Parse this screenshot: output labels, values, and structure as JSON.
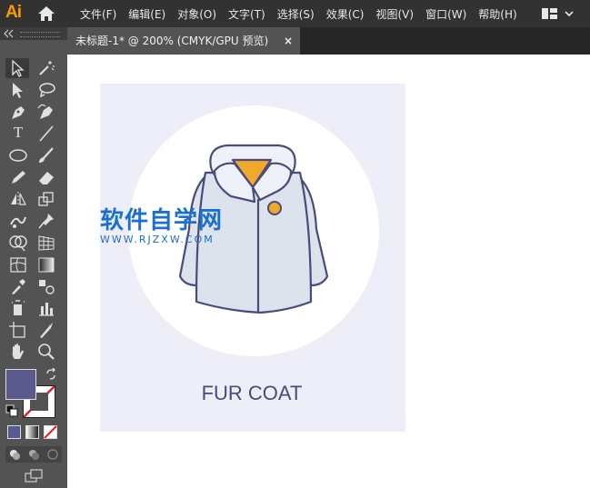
{
  "app": {
    "logo": "Ai"
  },
  "menu": [
    "文件(F)",
    "编辑(E)",
    "对象(O)",
    "文字(T)",
    "选择(S)",
    "效果(C)",
    "视图(V)",
    "窗口(W)",
    "帮助(H)"
  ],
  "tab": {
    "title": "未标题-1* @ 200% (CMYK/GPU 预览)",
    "close": "×"
  },
  "artwork": {
    "label": "FUR COAT"
  },
  "watermark": {
    "title": "软件自学网",
    "url": "WWW.RJZXW.COM"
  },
  "colors": {
    "accent": "#ff9a00",
    "fill_swatch": "#5b5a8f",
    "artboard_bg": "#eeeef8",
    "coat_body": "#dce3ec",
    "coat_outline": "#4a4a7c",
    "coat_collar_inner": "#f0a92b",
    "watermark": "#1a6fd0"
  },
  "toolbar_icons": [
    "selection-tool-icon",
    "magic-wand-icon",
    "direct-selection-icon",
    "lasso-icon",
    "pen-tool-icon",
    "curvature-tool-icon",
    "type-tool-icon",
    "line-tool-icon",
    "ellipse-tool-icon",
    "paintbrush-icon",
    "pencil-icon",
    "eraser-icon",
    "reflect-tool-icon",
    "scale-tool-icon",
    "warp-tool-icon",
    "pin-tool-icon",
    "shape-builder-icon",
    "perspective-grid-icon",
    "mesh-tool-icon",
    "gradient-tool-icon",
    "eyedropper-icon",
    "blend-tool-icon",
    "symbol-sprayer-icon",
    "graph-tool-icon",
    "artboard-tool-icon",
    "slice-tool-icon",
    "hand-tool-icon",
    "zoom-tool-icon"
  ]
}
